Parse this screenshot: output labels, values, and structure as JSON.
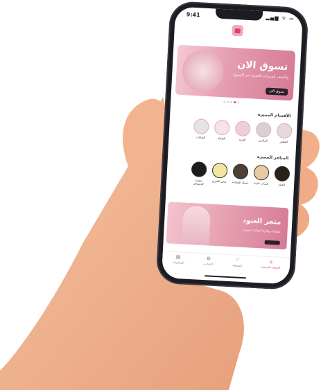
{
  "status_bar": {
    "time": "9:41",
    "icons": "▂▄▆ ⌔ ▭"
  },
  "hero_banner": {
    "title": "تسوق الان",
    "subtitle": "واكتشف المزيدات الحديثة عبر الاسبوع",
    "button_label": "تسوق الان",
    "dots_count": 5,
    "active_dot": 3
  },
  "featured_categories": {
    "title": "الأقسام المميزة",
    "items": [
      {
        "label": "العطور",
        "color": "#e8d7de"
      },
      {
        "label": "الملابس",
        "color": "#d9d0d6"
      },
      {
        "label": "الورود",
        "color": "#efcfd6"
      },
      {
        "label": "الطعام",
        "color": "#f2e4e8"
      },
      {
        "label": "العبايات",
        "color": "#e1e6e1"
      }
    ]
  },
  "featured_stores": {
    "title": "المتاجر المميزة",
    "items": [
      {
        "label": "العنود",
        "color": "#2a2018"
      },
      {
        "label": "قيمات حليمة",
        "color": "#e7c9a4"
      },
      {
        "label": "شيكة للعبايات",
        "color": "#4d3f36"
      },
      {
        "label": "سحر الشرق",
        "color": "#f2e7a2"
      },
      {
        "label": "سويت الدسوقي",
        "color": "#1d1d1d"
      }
    ]
  },
  "promo_banner": {
    "title": "متجر العنود",
    "subtitle": "بالعبايات والأزياء الملكية العصرية"
  },
  "tab_bar": {
    "items": [
      {
        "label": "الصفحة الرئيسية",
        "icon": "home-icon",
        "active": true
      },
      {
        "label": "المفضلة",
        "icon": "heart-icon",
        "active": false
      },
      {
        "label": "الاعدادت",
        "icon": "gear-icon",
        "active": false
      },
      {
        "label": "المشتريات",
        "icon": "bag-icon",
        "active": false
      }
    ]
  },
  "colors": {
    "accent": "#d9456e",
    "skin": "#f1b08a"
  }
}
